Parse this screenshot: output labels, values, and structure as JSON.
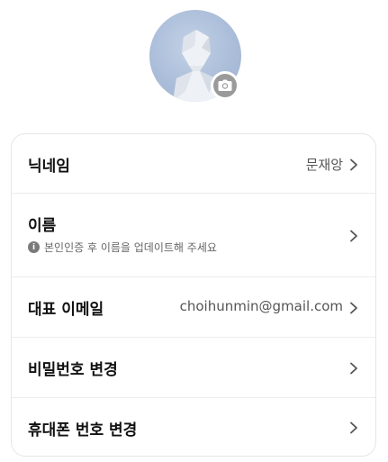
{
  "profile": {
    "avatar_icon": "default-avatar-icon",
    "camera_icon": "camera-icon"
  },
  "rows": [
    {
      "label": "닉네임",
      "value": "문재앙",
      "icon": "chevron-right-icon"
    },
    {
      "label": "이름",
      "hint": "본인인증 후 이름을 업데이트해 주세요",
      "hint_icon": "info-icon",
      "icon": "chevron-right-icon"
    },
    {
      "label": "대표 이메일",
      "value": "choihunmin@gmail.com",
      "icon": "chevron-right-icon"
    },
    {
      "label": "비밀번호 변경",
      "icon": "chevron-right-icon"
    },
    {
      "label": "휴대폰 번호 변경",
      "icon": "chevron-right-icon"
    }
  ],
  "colors": {
    "avatar_bg": "#a9bcd8",
    "border": "#e6e6e6",
    "text": "#111111",
    "subtext": "#666666"
  }
}
